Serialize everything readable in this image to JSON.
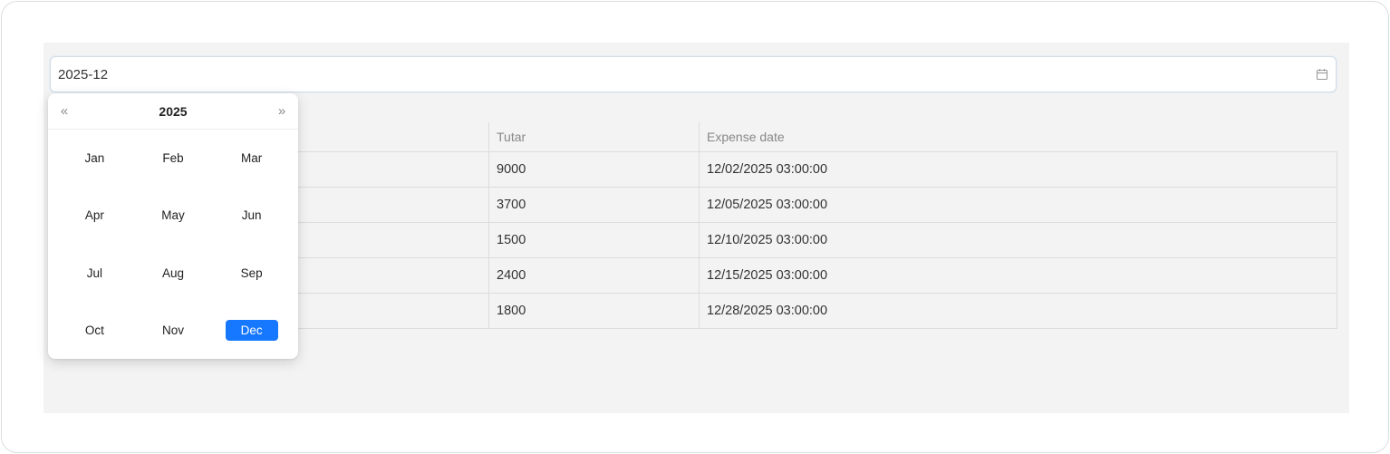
{
  "date_picker": {
    "value": "2025-12",
    "icon": "calendar-icon"
  },
  "table": {
    "headers": [
      "",
      "Tutar",
      "Expense date"
    ],
    "rows": [
      {
        "c1": "",
        "amount": "9000",
        "date": "12/02/2025 03:00:00"
      },
      {
        "c1": "",
        "amount": "3700",
        "date": "12/05/2025 03:00:00"
      },
      {
        "c1": "",
        "amount": "1500",
        "date": "12/10/2025 03:00:00"
      },
      {
        "c1": "",
        "amount": "2400",
        "date": "12/15/2025 03:00:00"
      },
      {
        "c1": "",
        "amount": "1800",
        "date": "12/28/2025 03:00:00"
      }
    ]
  },
  "calendar": {
    "prev_year": "«",
    "next_year": "»",
    "year": "2025",
    "months": [
      "Jan",
      "Feb",
      "Mar",
      "Apr",
      "May",
      "Jun",
      "Jul",
      "Aug",
      "Sep",
      "Oct",
      "Nov",
      "Dec"
    ],
    "selected": "Dec",
    "accent_color": "#1677ff"
  }
}
